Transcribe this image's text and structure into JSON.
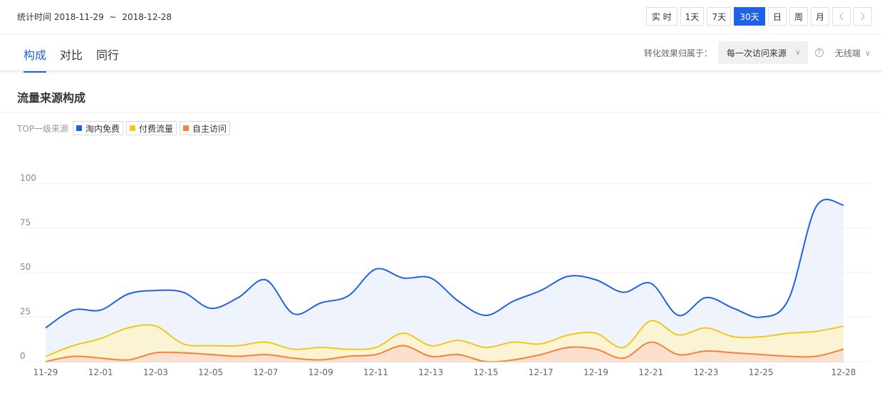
{
  "header": {
    "period_label": "统计时间",
    "start_date": "2018-11-29",
    "separator": "~",
    "end_date": "2018-12-28",
    "range_buttons": [
      {
        "label": "实 时",
        "wide": true,
        "active": false
      },
      {
        "label": "1天",
        "active": false
      },
      {
        "label": "7天",
        "active": false
      },
      {
        "label": "30天",
        "wide": true,
        "active": true
      },
      {
        "label": "日",
        "active": false
      },
      {
        "label": "周",
        "active": false
      },
      {
        "label": "月",
        "active": false
      }
    ],
    "prev_icon": "chevron-left-icon",
    "next_icon": "chevron-right-icon"
  },
  "tabs": [
    {
      "label": "构成",
      "active": true
    },
    {
      "label": "对比",
      "active": false
    },
    {
      "label": "同行",
      "active": false
    }
  ],
  "attribution": {
    "label": "转化效果归属于：",
    "selected": "每一次访问来源",
    "help_icon": "help-icon",
    "device": "无线端"
  },
  "section": {
    "title": "流量来源构成"
  },
  "chart_data": {
    "type": "area",
    "legend_title": "TOP一级来源",
    "legend_position": "top-left",
    "grid": true,
    "x": [
      "11-29",
      "11-30",
      "12-01",
      "12-02",
      "12-03",
      "12-04",
      "12-05",
      "12-06",
      "12-07",
      "12-08",
      "12-09",
      "12-10",
      "12-11",
      "12-12",
      "12-13",
      "12-14",
      "12-15",
      "12-16",
      "12-17",
      "12-18",
      "12-19",
      "12-20",
      "12-21",
      "12-22",
      "12-23",
      "12-24",
      "12-25",
      "12-26",
      "12-27",
      "12-28"
    ],
    "x_tick_labels": [
      "11-29",
      "12-01",
      "12-03",
      "12-05",
      "12-07",
      "12-09",
      "12-11",
      "12-13",
      "12-15",
      "12-17",
      "12-19",
      "12-21",
      "12-23",
      "12-25",
      "12-28"
    ],
    "ylim": [
      0,
      100
    ],
    "y_ticks": [
      0,
      25,
      50,
      75,
      100
    ],
    "series": [
      {
        "name": "淘内免费",
        "color": "#2062e6",
        "fill": "#ecf1fb",
        "values": [
          19,
          29,
          29,
          38,
          40,
          39,
          30,
          36,
          46,
          27,
          33,
          37,
          52,
          47,
          47,
          34,
          26,
          34,
          40,
          48,
          46,
          39,
          44,
          26,
          36,
          30,
          25,
          35,
          87,
          88
        ]
      },
      {
        "name": "付费流量",
        "color": "#f2c81e",
        "fill": "#fcf3cd",
        "values": [
          3,
          9,
          13,
          19,
          20,
          10,
          9,
          9,
          11,
          7,
          8,
          7,
          8,
          16,
          9,
          12,
          8,
          11,
          10,
          15,
          16,
          8,
          23,
          15,
          19,
          14,
          14,
          16,
          17,
          20
        ]
      },
      {
        "name": "自主访问",
        "color": "#f5823c",
        "fill": "#fcdccb",
        "values": [
          0,
          3,
          2,
          1,
          5,
          5,
          4,
          3,
          4,
          2,
          1,
          3,
          4,
          9,
          3,
          4,
          0,
          1,
          4,
          8,
          7,
          2,
          11,
          4,
          6,
          5,
          4,
          3,
          3,
          7
        ]
      }
    ]
  }
}
